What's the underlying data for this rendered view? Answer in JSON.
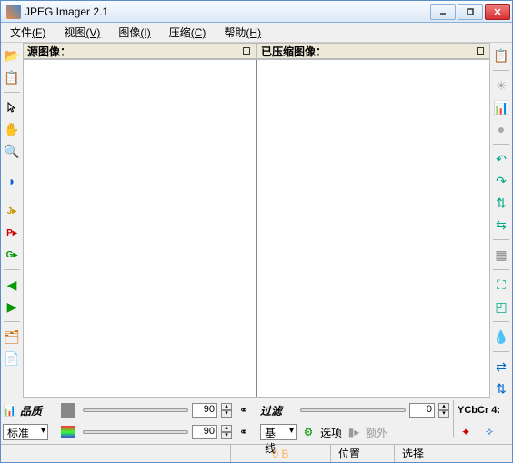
{
  "title": "JPEG Imager 2.1",
  "menu": {
    "file": "文件",
    "file_k": "(F)",
    "view": "视图",
    "view_k": "(V)",
    "image": "图像",
    "image_k": "(I)",
    "compress": "压缩",
    "compress_k": "(C)",
    "help": "帮助",
    "help_k": "(H)"
  },
  "panes": {
    "source": "源图像：",
    "compressed": "已压缩图像："
  },
  "bottom": {
    "quality_label": "品质",
    "preset": "标准",
    "spin1": "90",
    "spin2": "90",
    "filter_label": "过滤",
    "filter_spin": "0",
    "baseline": "基线",
    "options": "选项",
    "extra": "额外",
    "sampling": "YCbCr 4:"
  },
  "status": {
    "size": "0 B",
    "pos": "位置",
    "sel": "选择"
  }
}
